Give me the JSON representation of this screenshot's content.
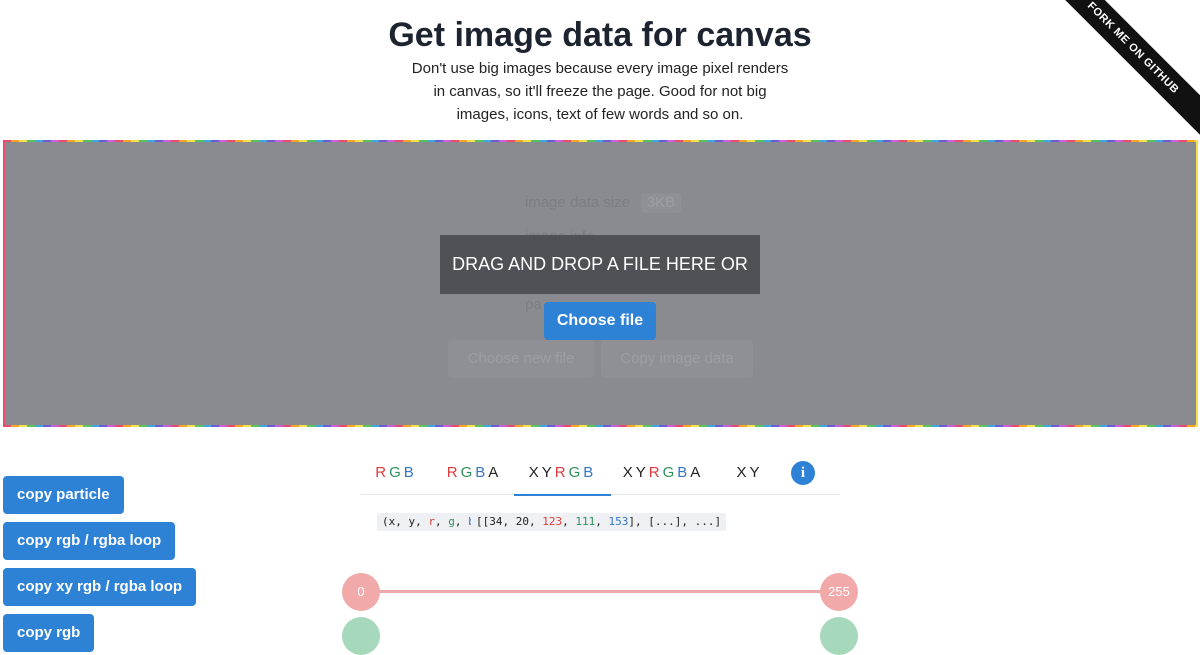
{
  "header": {
    "title": "Get image data for canvas",
    "subtitle_lines": [
      "Don't use big images because every image pixel renders",
      "in canvas, so it'll freeze the page. Good for not big",
      "images, icons, text of few words and so on."
    ],
    "ribbon": "FORK ME ON GITHUB"
  },
  "dropzone": {
    "prompt": "DRAG AND DROP A FILE HERE OR",
    "choose_file_label": "Choose file",
    "bg_label_image_data_size": "image data size",
    "bg_value_size": "3KB",
    "bg_label_image_info": "image info",
    "bg_label_partial": "pa",
    "bg_choose_new_file": "Choose new file",
    "bg_copy_image_data": "Copy image data"
  },
  "copy_buttons": [
    "copy particle",
    "copy rgb / rgba loop",
    "copy xy rgb / rgba loop",
    "copy rgb"
  ],
  "tabs": [
    {
      "label": "RGB",
      "active": false
    },
    {
      "label": "RGBA",
      "active": false
    },
    {
      "label": "XYRGB",
      "active": true
    },
    {
      "label": "XYRGBA",
      "active": false
    },
    {
      "label": "XY",
      "active": false
    }
  ],
  "info_icon": "info-icon",
  "format": {
    "signature": [
      "(x, y, ",
      "r",
      ", ",
      "g",
      ", ",
      "b",
      ")"
    ],
    "example": [
      "[[34, 20, ",
      "123",
      ", ",
      "111",
      ", ",
      "153",
      "], [...], ...]"
    ]
  },
  "slider": {
    "min_label": "0",
    "max_label": "255"
  },
  "colors": {
    "accent": "#2d82d6",
    "red": "#e03b3b",
    "green": "#2f8f5b",
    "blue": "#3577c4"
  }
}
